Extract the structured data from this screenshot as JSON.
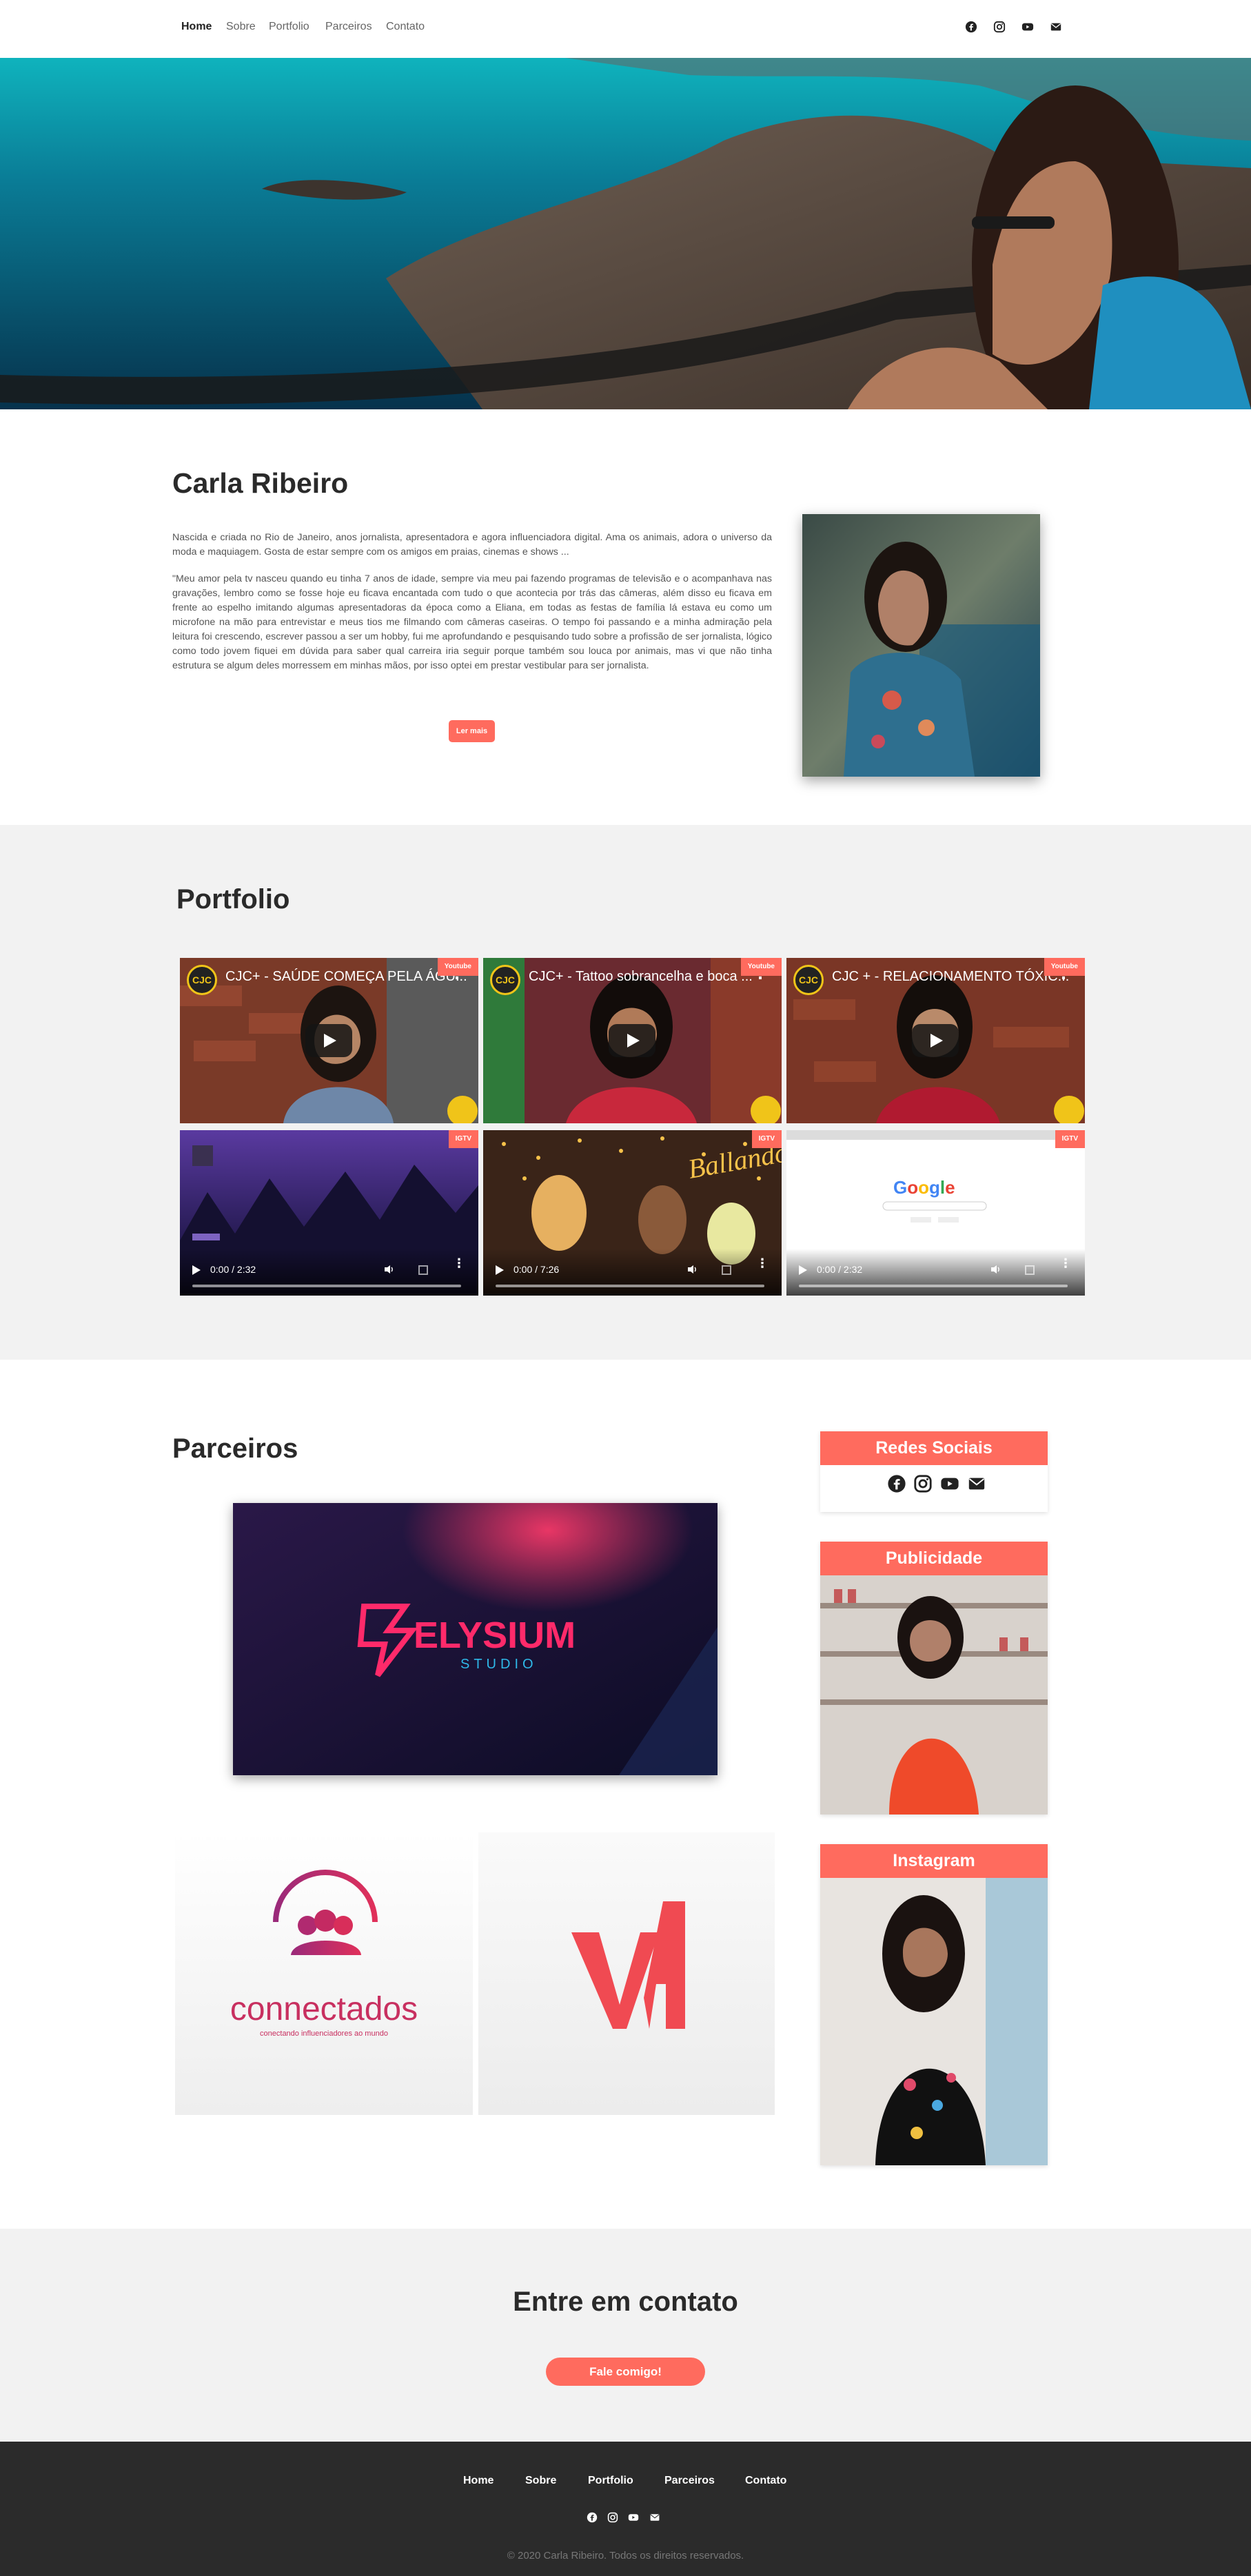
{
  "nav": {
    "links": [
      "Home",
      "Sobre",
      "Portfolio",
      "Parceiros",
      "Contato"
    ],
    "social_icons": [
      "facebook-icon",
      "instagram-icon",
      "youtube-icon",
      "envelope-icon"
    ]
  },
  "about": {
    "title": "Carla Ribeiro",
    "intro": "Nascida e criada no Rio de Janeiro, anos jornalista, apresentadora e agora influenciadora digital. Ama os animais, adora o universo da moda e maquiagem. Gosta de estar sempre com os amigos em praias, cinemas e shows ...",
    "story": "\"Meu amor pela tv nasceu quando eu tinha 7 anos de idade, sempre via meu pai fazendo programas de televisão e o acompanhava nas gravações, lembro como se fosse hoje eu ficava encantada com tudo o que acontecia por trás das câmeras, além disso eu ficava em frente ao espelho imitando algumas apresentadoras da época como a Eliana, em todas as festas de família lá estava eu como um microfone na mão para entrevistar e meus tios me filmando com câmeras caseiras. O tempo foi passando e a minha admiração pela leitura foi crescendo, escrever passou a ser um hobby, fui me aprofundando e pesquisando tudo sobre a profissão de ser jornalista, lógico como todo jovem fiquei em dúvida para saber qual carreira iria seguir porque também sou louca por animais, mas vi que não tinha estrutura se algum deles morressem em minhas mãos, por isso optei em prestar vestibular para ser jornalista.",
    "read_more": "Ler mais"
  },
  "portfolio": {
    "title": "Portfolio",
    "youtube": [
      {
        "title": "CJC+ - SAÚDE COMEÇA PELA ÁGU...",
        "badge": "Youtube",
        "logo": "CJC"
      },
      {
        "title": "CJC+ - Tattoo sobrancelha e boca ...",
        "badge": "Youtube",
        "logo": "CJC"
      },
      {
        "title": "CJC + - RELACIONAMENTO TÓXIC...",
        "badge": "Youtube",
        "logo": "CJC"
      }
    ],
    "videos": [
      {
        "time": "0:00 / 2:32",
        "badge": "IGTV"
      },
      {
        "time": "0:00 / 7:26",
        "badge": "IGTV"
      },
      {
        "time": "0:00 / 2:32",
        "badge": "IGTV"
      }
    ]
  },
  "parceiros": {
    "title": "Parceiros",
    "elysium_name": "ELYSIUM",
    "elysium_sub": "STUDIO",
    "connectados_name": "connectados",
    "connectados_tagline": "conectando influenciadores ao mundo",
    "va_logo": "VA"
  },
  "sidebar": {
    "social_title": "Redes Sociais",
    "publicidade_title": "Publicidade",
    "instagram_title": "Instagram"
  },
  "contact": {
    "title": "Entre em contato",
    "button": "Fale comigo!"
  },
  "footer": {
    "links": [
      "Home",
      "Sobre",
      "Portfolio",
      "Parceiros",
      "Contato"
    ],
    "copyright": "© 2020 Carla Ribeiro. Todos os direitos reservados."
  },
  "colors": {
    "accent": "#ff6b5e",
    "footer_bg": "#2b2b2b",
    "section_bg": "#f2f2f2"
  }
}
